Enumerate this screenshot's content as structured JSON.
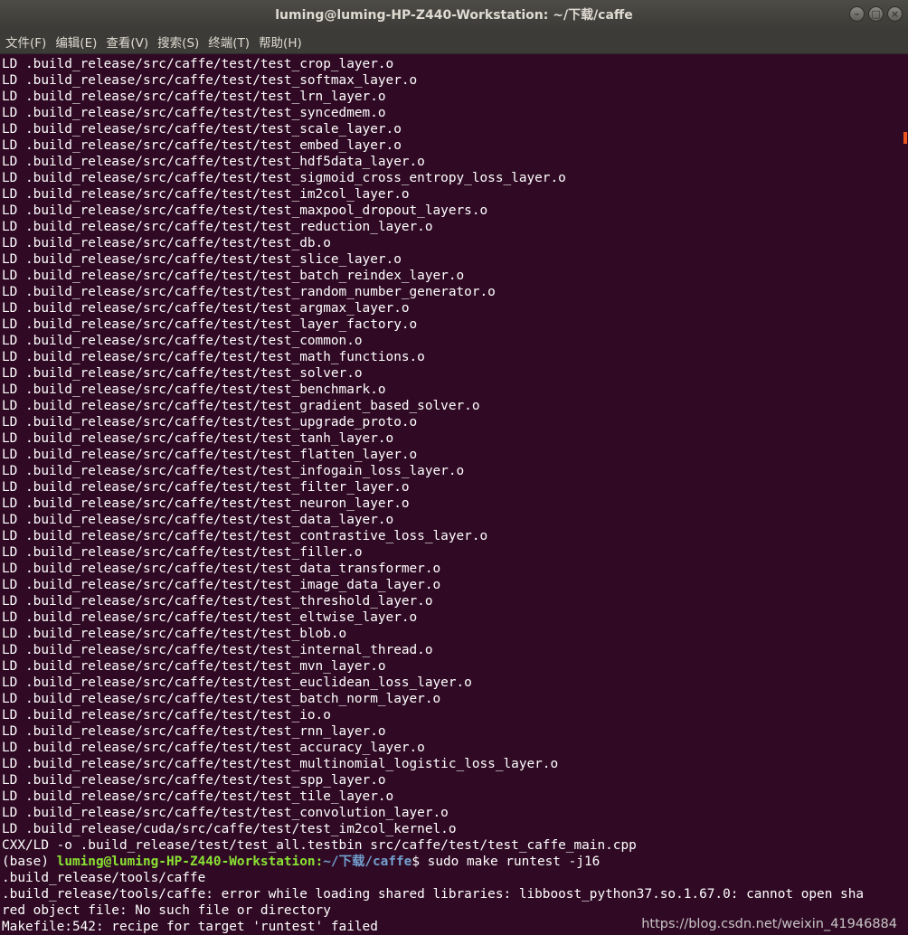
{
  "window": {
    "title": "luming@luming-HP-Z440-Workstation: ~/下载/caffe",
    "minimize_glyph": "–",
    "maximize_glyph": "□",
    "close_glyph": "×",
    "minimize_icon": "minimize-icon",
    "maximize_icon": "maximize-icon",
    "close_icon": "close-icon"
  },
  "menu": [
    {
      "label": "文件(F)"
    },
    {
      "label": "编辑(E)"
    },
    {
      "label": "查看(V)"
    },
    {
      "label": "搜索(S)"
    },
    {
      "label": "终端(T)"
    },
    {
      "label": "帮助(H)"
    }
  ],
  "colors": {
    "terminal_bg": "#300a24",
    "prompt_user": "#8ae234",
    "prompt_path": "#729fcf",
    "scrollbar_accent": "#e95420"
  },
  "terminal": {
    "lines": [
      "LD .build_release/src/caffe/test/test_crop_layer.o",
      "LD .build_release/src/caffe/test/test_softmax_layer.o",
      "LD .build_release/src/caffe/test/test_lrn_layer.o",
      "LD .build_release/src/caffe/test/test_syncedmem.o",
      "LD .build_release/src/caffe/test/test_scale_layer.o",
      "LD .build_release/src/caffe/test/test_embed_layer.o",
      "LD .build_release/src/caffe/test/test_hdf5data_layer.o",
      "LD .build_release/src/caffe/test/test_sigmoid_cross_entropy_loss_layer.o",
      "LD .build_release/src/caffe/test/test_im2col_layer.o",
      "LD .build_release/src/caffe/test/test_maxpool_dropout_layers.o",
      "LD .build_release/src/caffe/test/test_reduction_layer.o",
      "LD .build_release/src/caffe/test/test_db.o",
      "LD .build_release/src/caffe/test/test_slice_layer.o",
      "LD .build_release/src/caffe/test/test_batch_reindex_layer.o",
      "LD .build_release/src/caffe/test/test_random_number_generator.o",
      "LD .build_release/src/caffe/test/test_argmax_layer.o",
      "LD .build_release/src/caffe/test/test_layer_factory.o",
      "LD .build_release/src/caffe/test/test_common.o",
      "LD .build_release/src/caffe/test/test_math_functions.o",
      "LD .build_release/src/caffe/test/test_solver.o",
      "LD .build_release/src/caffe/test/test_benchmark.o",
      "LD .build_release/src/caffe/test/test_gradient_based_solver.o",
      "LD .build_release/src/caffe/test/test_upgrade_proto.o",
      "LD .build_release/src/caffe/test/test_tanh_layer.o",
      "LD .build_release/src/caffe/test/test_flatten_layer.o",
      "LD .build_release/src/caffe/test/test_infogain_loss_layer.o",
      "LD .build_release/src/caffe/test/test_filter_layer.o",
      "LD .build_release/src/caffe/test/test_neuron_layer.o",
      "LD .build_release/src/caffe/test/test_data_layer.o",
      "LD .build_release/src/caffe/test/test_contrastive_loss_layer.o",
      "LD .build_release/src/caffe/test/test_filler.o",
      "LD .build_release/src/caffe/test/test_data_transformer.o",
      "LD .build_release/src/caffe/test/test_image_data_layer.o",
      "LD .build_release/src/caffe/test/test_threshold_layer.o",
      "LD .build_release/src/caffe/test/test_eltwise_layer.o",
      "LD .build_release/src/caffe/test/test_blob.o",
      "LD .build_release/src/caffe/test/test_internal_thread.o",
      "LD .build_release/src/caffe/test/test_mvn_layer.o",
      "LD .build_release/src/caffe/test/test_euclidean_loss_layer.o",
      "LD .build_release/src/caffe/test/test_batch_norm_layer.o",
      "LD .build_release/src/caffe/test/test_io.o",
      "LD .build_release/src/caffe/test/test_rnn_layer.o",
      "LD .build_release/src/caffe/test/test_accuracy_layer.o",
      "LD .build_release/src/caffe/test/test_multinomial_logistic_loss_layer.o",
      "LD .build_release/src/caffe/test/test_spp_layer.o",
      "LD .build_release/src/caffe/test/test_tile_layer.o",
      "LD .build_release/src/caffe/test/test_convolution_layer.o",
      "LD .build_release/cuda/src/caffe/test/test_im2col_kernel.o",
      "CXX/LD -o .build_release/test/test_all.testbin src/caffe/test/test_caffe_main.cpp"
    ],
    "prompt": {
      "env": "(base) ",
      "user_host": "luming@luming-HP-Z440-Workstation",
      "sep": ":",
      "path": "~/下载/caffe",
      "symbol": "$ ",
      "command": "sudo make runtest -j16"
    },
    "after_lines": [
      ".build_release/tools/caffe",
      ".build_release/tools/caffe: error while loading shared libraries: libboost_python37.so.1.67.0: cannot open sha",
      "red object file: No such file or directory",
      "Makefile:542: recipe for target 'runtest' failed"
    ]
  },
  "watermark": "https://blog.csdn.net/weixin_41946884"
}
